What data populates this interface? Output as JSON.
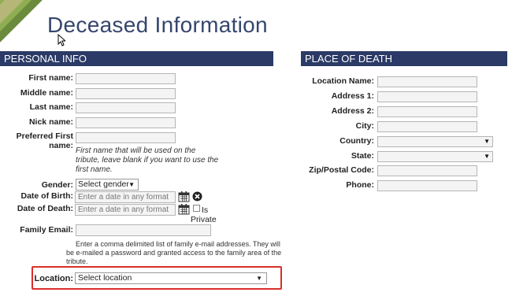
{
  "page": {
    "title": "Deceased Information"
  },
  "personal": {
    "header": "PERSONAL INFO",
    "first_name_label": "First name:",
    "middle_name_label": "Middle name:",
    "last_name_label": "Last name:",
    "nick_name_label": "Nick name:",
    "preferred_first_label_1": "Preferred First",
    "preferred_first_label_2": "name:",
    "preferred_help_1": "First name that will be used on the",
    "preferred_help_2": "tribute, leave blank if you want to use the",
    "preferred_help_3": "first name.",
    "gender_label": "Gender:",
    "gender_value": "Select gender",
    "dob_label": "Date of Birth:",
    "dob_placeholder": "Enter a date in any format",
    "dod_label": "Date of Death:",
    "dod_placeholder": "Enter a date in any format",
    "is_private_1": "Is",
    "is_private_2": "Private",
    "family_email_label": "Family Email:",
    "family_note_1": "Enter a comma delimited list of family e-mail addresses. They will",
    "family_note_2": "be e-mailed a password and granted access to the family area of the",
    "family_note_3": "tribute.",
    "location_label": "Location:",
    "location_value": "Select location"
  },
  "place": {
    "header": "PLACE OF DEATH",
    "location_name_label": "Location Name:",
    "address1_label": "Address 1:",
    "address2_label": "Address 2:",
    "city_label": "City:",
    "country_label": "Country:",
    "state_label": "State:",
    "zip_label": "Zip/Postal Code:",
    "phone_label": "Phone:"
  },
  "colors": {
    "header_bg": "#2b3a66",
    "title": "#35466e",
    "highlight": "#d9302a"
  },
  "icons": [
    "calendar-icon",
    "clear-icon",
    "dropdown-arrow-icon",
    "cursor-icon"
  ]
}
